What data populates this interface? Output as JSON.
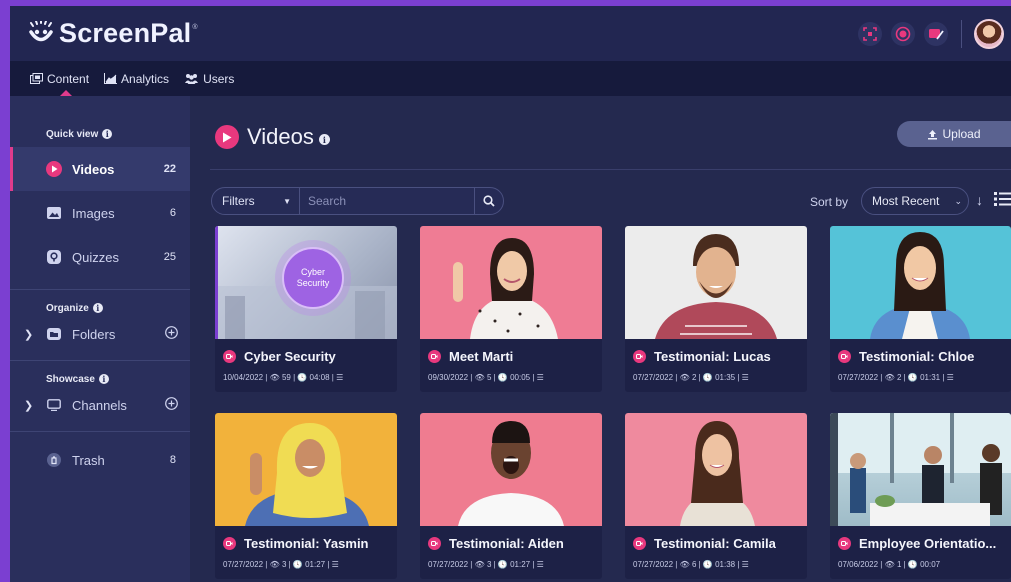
{
  "app": {
    "name": "ScreenPal",
    "reg_mark": "®"
  },
  "top_icons": [
    "capture-icon",
    "record-icon",
    "video-edit-icon"
  ],
  "colors": {
    "accent_pink": "#e8387e",
    "brand_purple": "#7b3fd1",
    "bg": "#24294f",
    "sidebar": "#2a2f5c"
  },
  "nav": {
    "tabs": [
      {
        "label": "Content",
        "icon": "content-icon",
        "active": true
      },
      {
        "label": "Analytics",
        "icon": "analytics-icon",
        "active": false
      },
      {
        "label": "Users",
        "icon": "users-icon",
        "active": false
      }
    ]
  },
  "sidebar": {
    "quick_view": "Quick view",
    "organize": "Organize",
    "showcase": "Showcase",
    "items": {
      "videos": {
        "label": "Videos",
        "count": "22"
      },
      "images": {
        "label": "Images",
        "count": "6"
      },
      "quizzes": {
        "label": "Quizzes",
        "count": "25"
      },
      "folders": {
        "label": "Folders"
      },
      "channels": {
        "label": "Channels"
      },
      "trash": {
        "label": "Trash",
        "count": "8"
      }
    }
  },
  "main": {
    "title": "Videos",
    "upload_label": "Upload",
    "filters_label": "Filters",
    "search_placeholder": "Search",
    "sort_label": "Sort by",
    "sort_value": "Most Recent"
  },
  "cards": [
    {
      "title": "Cyber Security",
      "meta": "10/04/2022 | 👁 59 | 🕓 04:08 | ☰"
    },
    {
      "title": "Meet Marti",
      "meta": "09/30/2022 | 👁 5 | 🕓 00:05 | ☰"
    },
    {
      "title": "Testimonial: Lucas",
      "meta": "07/27/2022 | 👁 2 | 🕓 01:35 | ☰"
    },
    {
      "title": "Testimonial: Chloe",
      "meta": "07/27/2022 | 👁 2 | 🕓 01:31 | ☰"
    },
    {
      "title": "Testimonial: Yasmin",
      "meta": "07/27/2022 | 👁 3 | 🕓 01:27 | ☰"
    },
    {
      "title": "Testimonial: Aiden",
      "meta": "07/27/2022 | 👁 3 | 🕓 01:27 | ☰"
    },
    {
      "title": "Testimonial: Camila",
      "meta": "07/27/2022 | 👁 6 | 🕓 01:38 | ☰"
    },
    {
      "title": "Employee Orientatio...",
      "meta": "07/06/2022 | 👁 1 | 🕓 00:07"
    }
  ],
  "thumb_text": {
    "cyber_line1": "Cyber",
    "cyber_line2": "Security"
  }
}
